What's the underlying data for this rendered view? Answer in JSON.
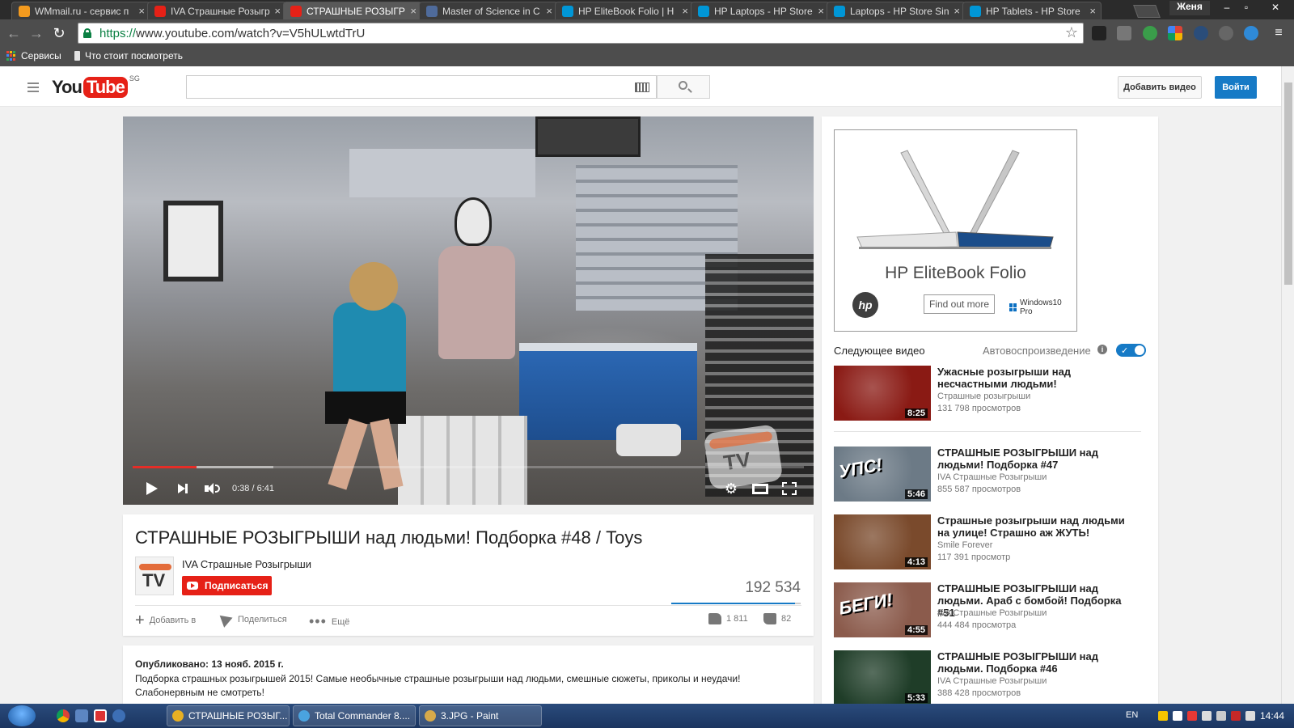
{
  "browser": {
    "tabs": [
      {
        "title": "WMmail.ru - сервис п",
        "favicon_color": "#f39a1e",
        "active": false
      },
      {
        "title": "IVA Страшные Розыгр",
        "favicon_color": "#e62117",
        "active": false
      },
      {
        "title": "СТРАШНЫЕ РОЗЫГР",
        "favicon_color": "#e62117",
        "active": true
      },
      {
        "title": "Master of Science in C",
        "favicon_color": "#4f6b9b",
        "active": false
      },
      {
        "title": "HP EliteBook Folio | H",
        "favicon_color": "#0096d6",
        "active": false
      },
      {
        "title": "HP Laptops - HP Store",
        "favicon_color": "#0096d6",
        "active": false
      },
      {
        "title": "Laptops - HP Store Sin",
        "favicon_color": "#0096d6",
        "active": false
      },
      {
        "title": "HP Tablets - HP Store",
        "favicon_color": "#0096d6",
        "active": false
      }
    ],
    "user_name": "Женя",
    "url_protocol": "https://",
    "url_rest": "www.youtube.com/watch?v=V5hULwtdTrU",
    "bookmarks": [
      "Сервисы",
      "Что стоит посмотреть"
    ]
  },
  "youtube": {
    "region": "SG",
    "upload_label": "Добавить видео",
    "signin_label": "Войти",
    "search_placeholder": ""
  },
  "player": {
    "current_time": "0:38",
    "duration": "6:41",
    "time_display": "0:38 / 6:41",
    "played_fraction": 0.095,
    "loaded_fraction": 0.21,
    "watermark_text": "TV"
  },
  "video": {
    "title": "СТРАШНЫЕ РОЗЫГРЫШИ над людьми! Подборка #48 / Toys",
    "channel": "IVA Страшные Розыгрыши",
    "subscribe_label": "Подписаться",
    "views": "192 534",
    "add_to_label": "Добавить в",
    "share_label": "Поделиться",
    "more_label": "Ещё",
    "likes": "1 811",
    "dislikes": "82",
    "like_fraction": 0.957,
    "published": "Опубликовано: 13 нояб. 2015 г.",
    "description": "Подборка страшных розыгрышей 2015! Самые необычные страшные розыгрыши над людьми, смешные сюжеты, приколы и неудачи! Слабонервным не смотреть!"
  },
  "ad": {
    "title": "HP EliteBook Folio",
    "cta": "Find out more",
    "badge": "Windows10 Pro",
    "logo": "hp"
  },
  "sidebar": {
    "up_next_label": "Следующее видео",
    "autoplay_label": "Автовоспроизведение",
    "autoplay_on": true,
    "related": [
      {
        "title": "Ужасные розыгрыши над несчастными людьми!",
        "channel": "Страшные розыгрыши",
        "views": "131 798 просмотров",
        "duration": "8:25",
        "thumb_color": "#8a1a14"
      },
      {
        "title": "СТРАШНЫЕ РОЗЫГРЫШИ над людьми! Подборка #47",
        "channel": "IVA Страшные Розыгрыши",
        "views": "855 587 просмотров",
        "duration": "5:46",
        "thumb_color": "#6c7a86",
        "thumb_text": "УПС!"
      },
      {
        "title": "Страшные розыгрыши над людьми на улице! Страшно аж ЖУТЬ!",
        "channel": "Smile Forever",
        "views": "117 391 просмотр",
        "duration": "4:13",
        "thumb_color": "#7a4a2c"
      },
      {
        "title": "СТРАШНЫЕ РОЗЫГРЫШИ над людьми. Араб с бомбой! Подборка #51",
        "channel": "IVA Страшные Розыгрыши",
        "views": "444 484 просмотра",
        "duration": "4:55",
        "thumb_color": "#8b5b4c",
        "thumb_text": "БЕГИ!"
      },
      {
        "title": "СТРАШНЫЕ РОЗЫГРЫШИ над людьми. Подборка #46",
        "channel": "IVA Страшные Розыгрыши",
        "views": "388 428 просмотров",
        "duration": "5:33",
        "thumb_color": "#1f3d28"
      }
    ]
  },
  "taskbar": {
    "tasks": [
      {
        "label": "СТРАШНЫЕ РОЗЫГ...",
        "icon_color": "#e8b023"
      },
      {
        "label": "Total Commander 8....",
        "icon_color": "#4aa3df"
      },
      {
        "label": "3.JPG - Paint",
        "icon_color": "#d6a94a"
      }
    ],
    "lang": "EN",
    "clock": "14:44"
  }
}
